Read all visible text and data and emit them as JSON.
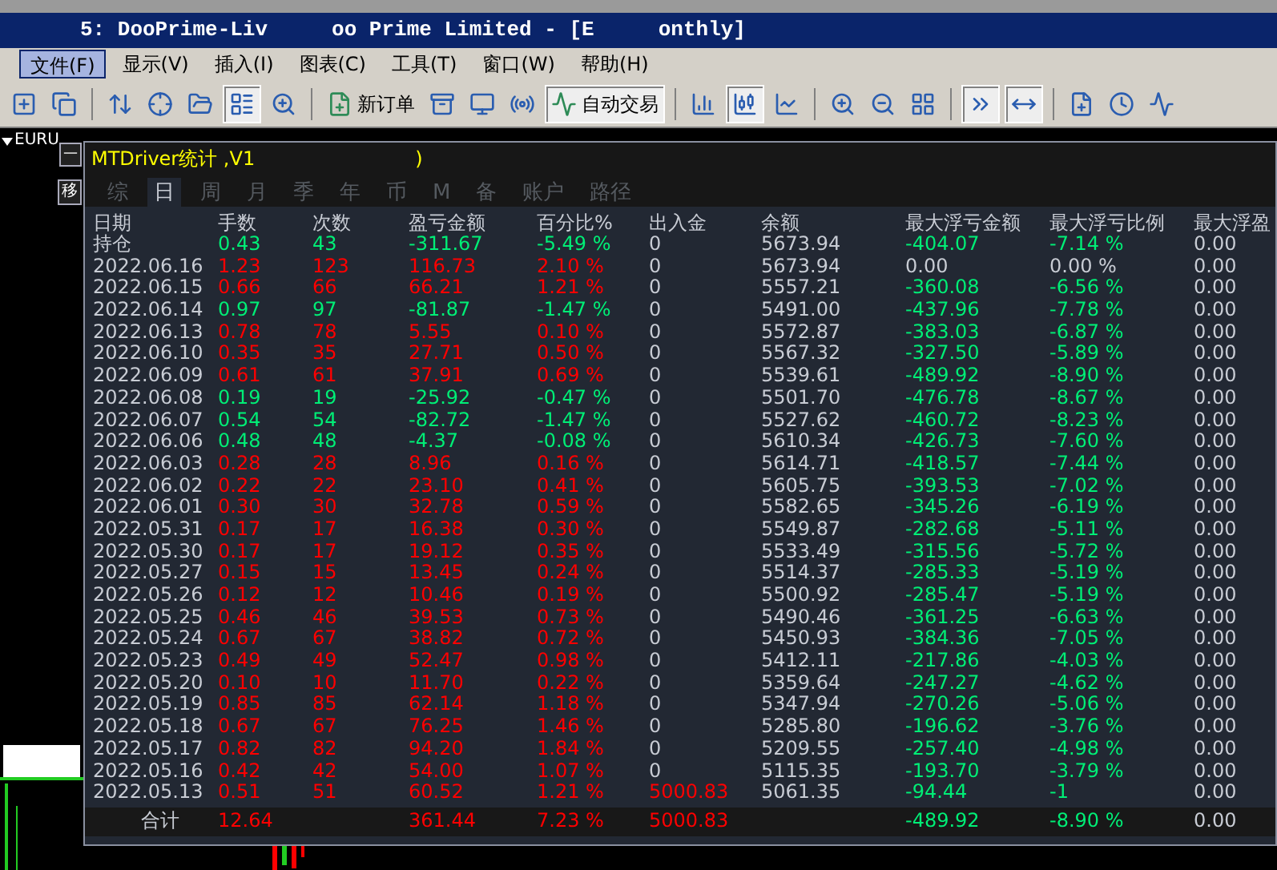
{
  "window": {
    "title_parts": [
      "5: DooPrime-Liv",
      "oo Prime Limited - [E",
      "onthly]"
    ]
  },
  "menu": [
    {
      "label": "文件(F)",
      "selected": true
    },
    {
      "label": "显示(V)",
      "selected": false
    },
    {
      "label": "插入(I)",
      "selected": false
    },
    {
      "label": "图表(C)",
      "selected": false
    },
    {
      "label": "工具(T)",
      "selected": false
    },
    {
      "label": "窗口(W)",
      "selected": false
    },
    {
      "label": "帮助(H)",
      "selected": false
    }
  ],
  "toolbar": [
    {
      "kind": "icon",
      "pressed": false
    },
    {
      "kind": "icon",
      "pressed": false
    },
    {
      "kind": "separator"
    },
    {
      "kind": "icon",
      "pressed": false
    },
    {
      "kind": "icon",
      "pressed": false
    },
    {
      "kind": "icon",
      "pressed": false
    },
    {
      "kind": "icon",
      "pressed": true
    },
    {
      "kind": "icon",
      "pressed": false
    },
    {
      "kind": "separator"
    },
    {
      "kind": "labeled",
      "label": "新订单",
      "pressed": false
    },
    {
      "kind": "icon",
      "pressed": false
    },
    {
      "kind": "icon",
      "pressed": false
    },
    {
      "kind": "icon",
      "pressed": false
    },
    {
      "kind": "labeled",
      "label": "自动交易",
      "pressed": true
    },
    {
      "kind": "separator"
    },
    {
      "kind": "icon",
      "pressed": false
    },
    {
      "kind": "icon",
      "pressed": true
    },
    {
      "kind": "icon",
      "pressed": false
    },
    {
      "kind": "separator"
    },
    {
      "kind": "icon",
      "pressed": false
    },
    {
      "kind": "icon",
      "pressed": false
    },
    {
      "kind": "icon",
      "pressed": false
    },
    {
      "kind": "separator"
    },
    {
      "kind": "icon",
      "pressed": true
    },
    {
      "kind": "icon",
      "pressed": true
    },
    {
      "kind": "separator"
    },
    {
      "kind": "icon",
      "pressed": false
    },
    {
      "kind": "icon",
      "pressed": false
    },
    {
      "kind": "icon",
      "pressed": false
    }
  ],
  "chart": {
    "symbol": "EURU"
  },
  "panel": {
    "title_parts": [
      "MTDriver统计 ,V1",
      ")"
    ],
    "side_buttons": [
      "—",
      "移"
    ],
    "tabs": [
      {
        "label": "综",
        "selected": false
      },
      {
        "label": "日",
        "selected": true
      },
      {
        "label": "周",
        "selected": false
      },
      {
        "label": "月",
        "selected": false
      },
      {
        "label": "季",
        "selected": false
      },
      {
        "label": "年",
        "selected": false
      },
      {
        "label": "币",
        "selected": false
      },
      {
        "label": "M",
        "selected": false
      },
      {
        "label": "备",
        "selected": false
      },
      {
        "label": "账户",
        "selected": false
      },
      {
        "label": "路径",
        "selected": false
      }
    ],
    "columns": [
      "日期",
      "手数",
      "次数",
      "盈亏金额",
      "百分比%",
      "出入金",
      "余额",
      "最大浮亏金额",
      "最大浮亏比例",
      "最大浮盈"
    ],
    "rows": [
      {
        "profit": false,
        "drawdown": true,
        "deposit": false,
        "cells": [
          "持仓",
          "0.43",
          "43",
          "-311.67",
          "-5.49 %",
          "0",
          "5673.94",
          "-404.07",
          "-7.14 %",
          "0.00"
        ]
      },
      {
        "profit": true,
        "drawdown": false,
        "deposit": false,
        "cells": [
          "2022.06.16",
          "1.23",
          "123",
          "116.73",
          "2.10 %",
          "0",
          "5673.94",
          "0.00",
          "0.00 %",
          "0.00"
        ]
      },
      {
        "profit": true,
        "drawdown": true,
        "deposit": false,
        "cells": [
          "2022.06.15",
          "0.66",
          "66",
          "66.21",
          "1.21 %",
          "0",
          "5557.21",
          "-360.08",
          "-6.56 %",
          "0.00"
        ]
      },
      {
        "profit": false,
        "drawdown": true,
        "deposit": false,
        "cells": [
          "2022.06.14",
          "0.97",
          "97",
          "-81.87",
          "-1.47 %",
          "0",
          "5491.00",
          "-437.96",
          "-7.78 %",
          "0.00"
        ]
      },
      {
        "profit": true,
        "drawdown": true,
        "deposit": false,
        "cells": [
          "2022.06.13",
          "0.78",
          "78",
          "5.55",
          "0.10 %",
          "0",
          "5572.87",
          "-383.03",
          "-6.87 %",
          "0.00"
        ]
      },
      {
        "profit": true,
        "drawdown": true,
        "deposit": false,
        "cells": [
          "2022.06.10",
          "0.35",
          "35",
          "27.71",
          "0.50 %",
          "0",
          "5567.32",
          "-327.50",
          "-5.89 %",
          "0.00"
        ]
      },
      {
        "profit": true,
        "drawdown": true,
        "deposit": false,
        "cells": [
          "2022.06.09",
          "0.61",
          "61",
          "37.91",
          "0.69 %",
          "0",
          "5539.61",
          "-489.92",
          "-8.90 %",
          "0.00"
        ]
      },
      {
        "profit": false,
        "drawdown": true,
        "deposit": false,
        "cells": [
          "2022.06.08",
          "0.19",
          "19",
          "-25.92",
          "-0.47 %",
          "0",
          "5501.70",
          "-476.78",
          "-8.67 %",
          "0.00"
        ]
      },
      {
        "profit": false,
        "drawdown": true,
        "deposit": false,
        "cells": [
          "2022.06.07",
          "0.54",
          "54",
          "-82.72",
          "-1.47 %",
          "0",
          "5527.62",
          "-460.72",
          "-8.23 %",
          "0.00"
        ]
      },
      {
        "profit": false,
        "drawdown": true,
        "deposit": false,
        "cells": [
          "2022.06.06",
          "0.48",
          "48",
          "-4.37",
          "-0.08 %",
          "0",
          "5610.34",
          "-426.73",
          "-7.60 %",
          "0.00"
        ]
      },
      {
        "profit": true,
        "drawdown": true,
        "deposit": false,
        "cells": [
          "2022.06.03",
          "0.28",
          "28",
          "8.96",
          "0.16 %",
          "0",
          "5614.71",
          "-418.57",
          "-7.44 %",
          "0.00"
        ]
      },
      {
        "profit": true,
        "drawdown": true,
        "deposit": false,
        "cells": [
          "2022.06.02",
          "0.22",
          "22",
          "23.10",
          "0.41 %",
          "0",
          "5605.75",
          "-393.53",
          "-7.02 %",
          "0.00"
        ]
      },
      {
        "profit": true,
        "drawdown": true,
        "deposit": false,
        "cells": [
          "2022.06.01",
          "0.30",
          "30",
          "32.78",
          "0.59 %",
          "0",
          "5582.65",
          "-345.26",
          "-6.19 %",
          "0.00"
        ]
      },
      {
        "profit": true,
        "drawdown": true,
        "deposit": false,
        "cells": [
          "2022.05.31",
          "0.17",
          "17",
          "16.38",
          "0.30 %",
          "0",
          "5549.87",
          "-282.68",
          "-5.11 %",
          "0.00"
        ]
      },
      {
        "profit": true,
        "drawdown": true,
        "deposit": false,
        "cells": [
          "2022.05.30",
          "0.17",
          "17",
          "19.12",
          "0.35 %",
          "0",
          "5533.49",
          "-315.56",
          "-5.72 %",
          "0.00"
        ]
      },
      {
        "profit": true,
        "drawdown": true,
        "deposit": false,
        "cells": [
          "2022.05.27",
          "0.15",
          "15",
          "13.45",
          "0.24 %",
          "0",
          "5514.37",
          "-285.33",
          "-5.19 %",
          "0.00"
        ]
      },
      {
        "profit": true,
        "drawdown": true,
        "deposit": false,
        "cells": [
          "2022.05.26",
          "0.12",
          "12",
          "10.46",
          "0.19 %",
          "0",
          "5500.92",
          "-285.47",
          "-5.19 %",
          "0.00"
        ]
      },
      {
        "profit": true,
        "drawdown": true,
        "deposit": false,
        "cells": [
          "2022.05.25",
          "0.46",
          "46",
          "39.53",
          "0.73 %",
          "0",
          "5490.46",
          "-361.25",
          "-6.63 %",
          "0.00"
        ]
      },
      {
        "profit": true,
        "drawdown": true,
        "deposit": false,
        "cells": [
          "2022.05.24",
          "0.67",
          "67",
          "38.82",
          "0.72 %",
          "0",
          "5450.93",
          "-384.36",
          "-7.05 %",
          "0.00"
        ]
      },
      {
        "profit": true,
        "drawdown": true,
        "deposit": false,
        "cells": [
          "2022.05.23",
          "0.49",
          "49",
          "52.47",
          "0.98 %",
          "0",
          "5412.11",
          "-217.86",
          "-4.03 %",
          "0.00"
        ]
      },
      {
        "profit": true,
        "drawdown": true,
        "deposit": false,
        "cells": [
          "2022.05.20",
          "0.10",
          "10",
          "11.70",
          "0.22 %",
          "0",
          "5359.64",
          "-247.27",
          "-4.62 %",
          "0.00"
        ]
      },
      {
        "profit": true,
        "drawdown": true,
        "deposit": false,
        "cells": [
          "2022.05.19",
          "0.85",
          "85",
          "62.14",
          "1.18 %",
          "0",
          "5347.94",
          "-270.26",
          "-5.06 %",
          "0.00"
        ]
      },
      {
        "profit": true,
        "drawdown": true,
        "deposit": false,
        "cells": [
          "2022.05.18",
          "0.67",
          "67",
          "76.25",
          "1.46 %",
          "0",
          "5285.80",
          "-196.62",
          "-3.76 %",
          "0.00"
        ]
      },
      {
        "profit": true,
        "drawdown": true,
        "deposit": false,
        "cells": [
          "2022.05.17",
          "0.82",
          "82",
          "94.20",
          "1.84 %",
          "0",
          "5209.55",
          "-257.40",
          "-4.98 %",
          "0.00"
        ]
      },
      {
        "profit": true,
        "drawdown": true,
        "deposit": false,
        "cells": [
          "2022.05.16",
          "0.42",
          "42",
          "54.00",
          "1.07 %",
          "0",
          "5115.35",
          "-193.70",
          "-3.79 %",
          "0.00"
        ]
      },
      {
        "profit": true,
        "drawdown": true,
        "deposit": true,
        "cells": [
          "2022.05.13",
          "0.51",
          "51",
          "60.52",
          "1.21 %",
          "5000.83",
          "5061.35",
          "-94.44",
          "-1",
          "0.00"
        ]
      }
    ],
    "totals": {
      "profit": true,
      "drawdown": true,
      "deposit": true,
      "cells": [
        "合计",
        "12.64",
        "",
        "361.44",
        "7.23 %",
        "5000.83",
        "",
        "-489.92",
        "-8.90 %",
        "0.00"
      ]
    }
  }
}
